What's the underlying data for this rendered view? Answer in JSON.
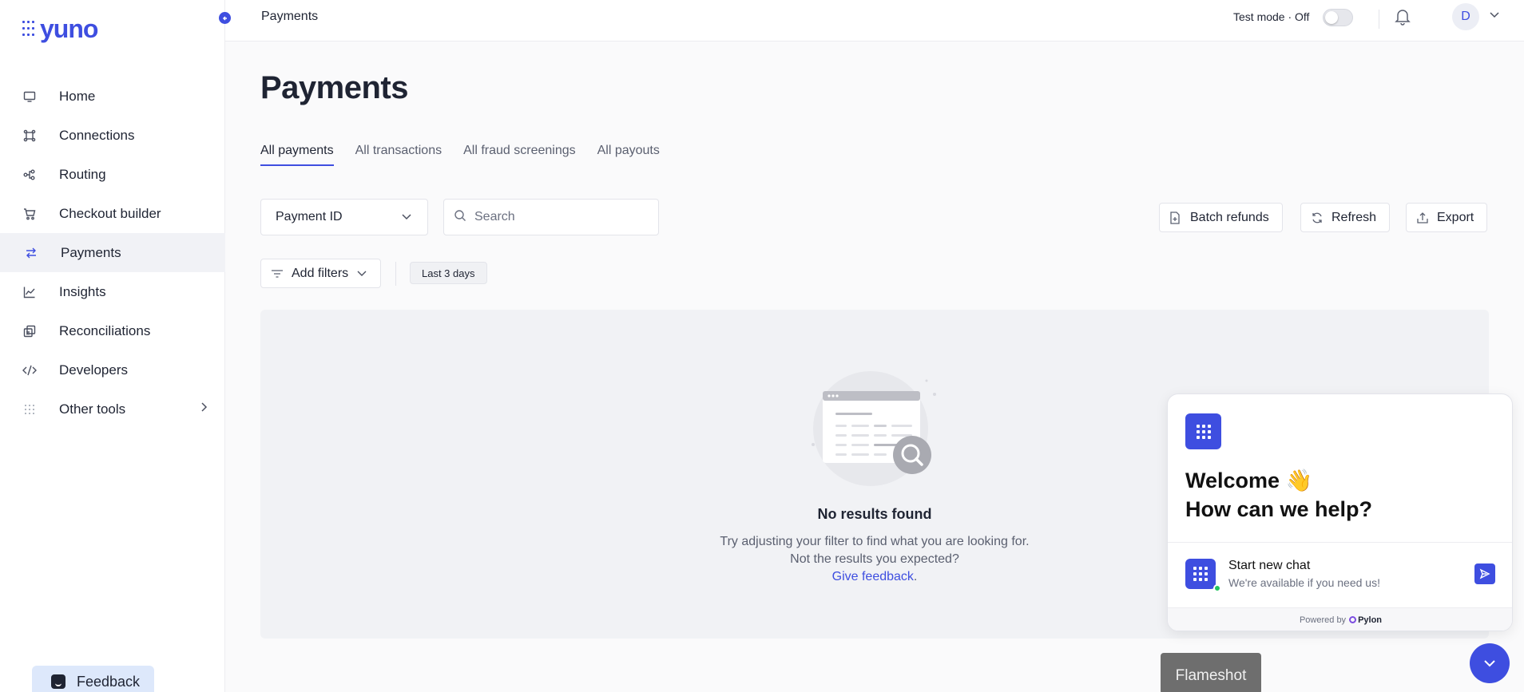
{
  "brand": {
    "logo_text": "yuno",
    "accent": "#3e4ee0"
  },
  "sidebar": {
    "items": [
      {
        "label": "Home",
        "icon": "monitor-icon"
      },
      {
        "label": "Connections",
        "icon": "connections-icon"
      },
      {
        "label": "Routing",
        "icon": "routing-icon"
      },
      {
        "label": "Checkout builder",
        "icon": "cart-icon"
      },
      {
        "label": "Payments",
        "icon": "arrows-exchange-icon",
        "active": true
      },
      {
        "label": "Insights",
        "icon": "line-chart-icon"
      },
      {
        "label": "Reconciliations",
        "icon": "reconcile-icon"
      },
      {
        "label": "Developers",
        "icon": "code-icon"
      },
      {
        "label": "Other tools",
        "icon": "grid-dots-icon"
      }
    ],
    "feedback_label": "Feedback"
  },
  "topbar": {
    "breadcrumb": "Payments",
    "test_mode_label": "Test mode · Off",
    "avatar_initial": "D"
  },
  "main": {
    "title": "Payments",
    "tabs": [
      {
        "label": "All payments",
        "active": true
      },
      {
        "label": "All transactions"
      },
      {
        "label": "All fraud screenings"
      },
      {
        "label": "All payouts"
      }
    ],
    "search_field_select": "Payment ID",
    "search_placeholder": "Search",
    "buttons": {
      "batch_refunds": "Batch refunds",
      "refresh": "Refresh",
      "export": "Export"
    },
    "add_filters_label": "Add filters",
    "date_chip": "Last 3 days",
    "empty_state": {
      "title": "No results found",
      "description": "Try adjusting your filter to find what you are looking for. Not the results you expected?",
      "link": "Give feedback",
      "link_suffix": "."
    }
  },
  "chat_widget": {
    "welcome": "Welcome 👋",
    "question": "How can we help?",
    "start_chat": "Start new chat",
    "availability": "We're available if you need us!",
    "powered_by": "Powered by",
    "powered_brand": "Pylon"
  },
  "overlay": {
    "flameshot_label": "Flameshot"
  }
}
